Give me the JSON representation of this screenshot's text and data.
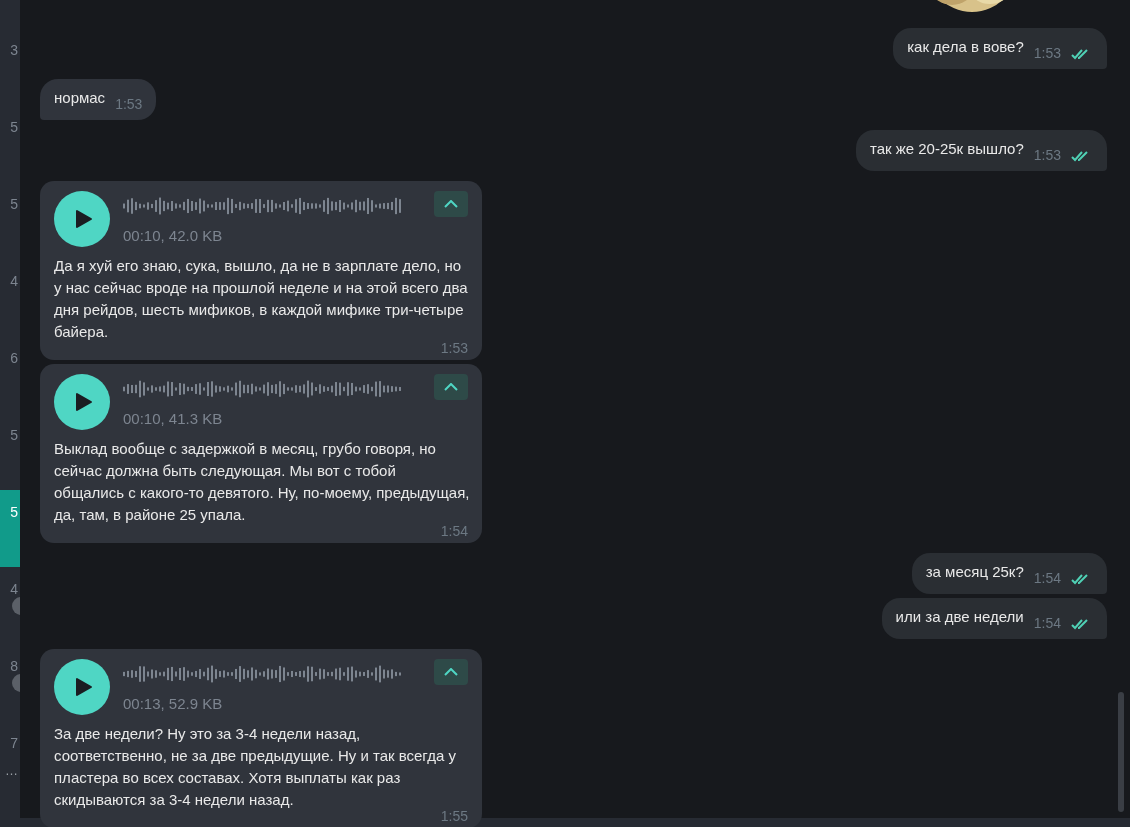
{
  "chat_list_strip": [
    {
      "text": "3",
      "selected": false,
      "badge": false
    },
    {
      "text": "5",
      "selected": false,
      "badge": false
    },
    {
      "text": "5",
      "selected": false,
      "badge": false
    },
    {
      "text": "4",
      "selected": false,
      "badge": false
    },
    {
      "text": "6",
      "selected": false,
      "badge": false
    },
    {
      "text": "5",
      "selected": false,
      "badge": false
    },
    {
      "text": "5",
      "selected": true,
      "badge": false
    },
    {
      "text": "4",
      "selected": false,
      "badge": true
    },
    {
      "text": "8",
      "selected": false,
      "badge": true
    },
    {
      "text": "7",
      "selected": false,
      "badge": false,
      "preview": "…"
    }
  ],
  "messages": [
    {
      "kind": "text",
      "outgoing": true,
      "text": "как дела в вове?",
      "time": "1:53",
      "read": true
    },
    {
      "kind": "text",
      "outgoing": false,
      "text": "нормас",
      "time": "1:53"
    },
    {
      "kind": "text",
      "outgoing": true,
      "text": "так же 20-25к вышло?",
      "time": "1:53",
      "read": true
    },
    {
      "kind": "voice",
      "outgoing": false,
      "meta": "00:10, 42.0 KB",
      "text": "Да я хуй его знаю, сука, вышло, да не в зарплате дело, но у нас сейчас вроде на прошлой неделе и на этой всего два дня рейдов, шесть мификов, в каждой мифике три-четыре байера.",
      "time": "1:53",
      "expanded": true
    },
    {
      "kind": "voice",
      "outgoing": false,
      "meta": "00:10, 41.3 KB",
      "text": "Выклад вообще с задержкой в месяц, грубо говоря, но сейчас должна быть следующая. Мы вот с тобой общались с какого-то девятого. Ну, по-моему, предыдущая, да, там, в районе 25 упала.",
      "time": "1:54",
      "expanded": true
    },
    {
      "kind": "text",
      "outgoing": true,
      "text": "за месяц 25к?",
      "time": "1:54",
      "read": true
    },
    {
      "kind": "text",
      "outgoing": true,
      "text": "или за две недели",
      "time": "1:54",
      "read": true
    },
    {
      "kind": "voice",
      "outgoing": false,
      "meta": "00:13, 52.9 KB",
      "text": "За две недели? Ну это за 3-4 недели назад, соответственно, не за две предыдущие. Ну и так всегда у пластера во всех составах. Хотя выплаты как раз скидываются за 3-4 недели назад.",
      "time": "1:55",
      "expanded": true
    }
  ]
}
